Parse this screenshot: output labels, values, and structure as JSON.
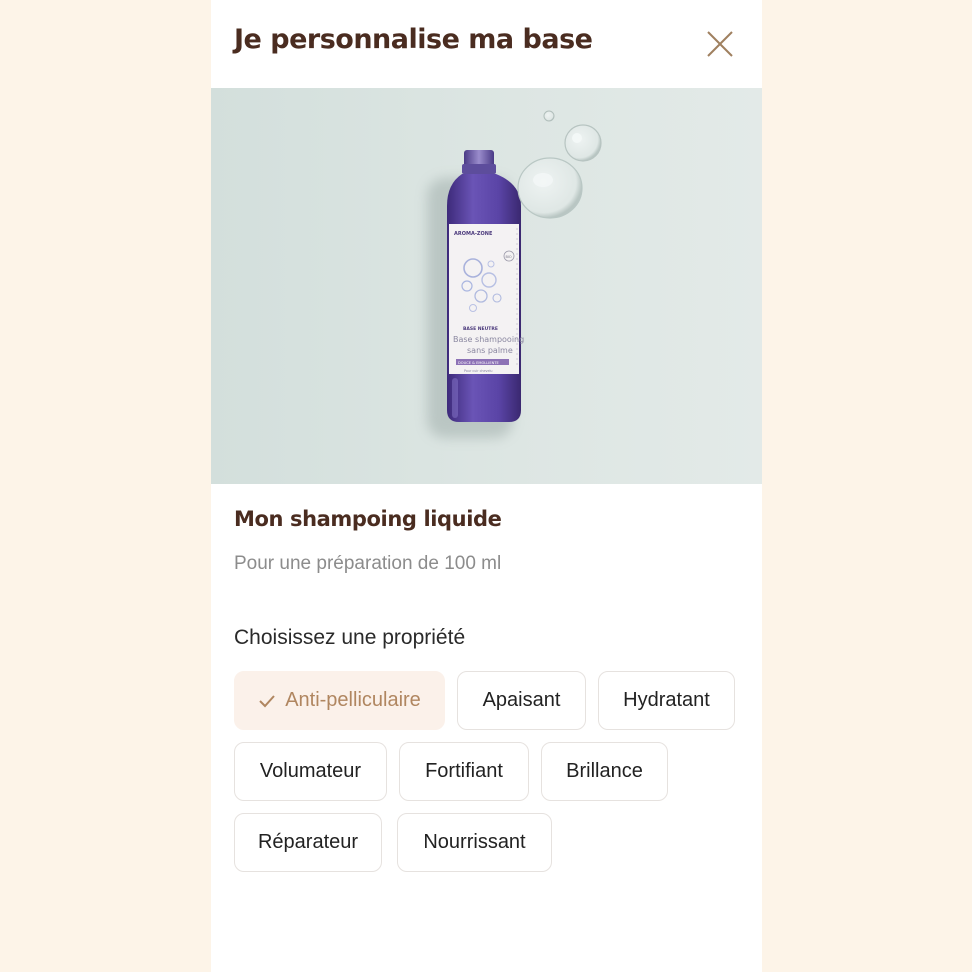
{
  "modal": {
    "title": "Je personnalise ma base",
    "close_icon": "close-icon"
  },
  "hero": {
    "image_desc_icon": "product-bottle-image",
    "label": {
      "brand": "AROMA-ZONE",
      "line1": "BASE NEUTRE",
      "line2": "Base shampooing",
      "line3": "sans palme",
      "band": "DOUCE & EMOLLIENTE",
      "small": "Pour cuir chevelu",
      "badge": "BIO"
    }
  },
  "product": {
    "title": "Mon shampoing liquide",
    "subtitle": "Pour une préparation de 100 ml"
  },
  "properties": {
    "heading": "Choisissez une propriété",
    "options": [
      {
        "label": "Anti-pelliculaire",
        "selected": true
      },
      {
        "label": "Apaisant",
        "selected": false
      },
      {
        "label": "Hydratant",
        "selected": false
      },
      {
        "label": "Volumateur",
        "selected": false
      },
      {
        "label": "Fortifiant",
        "selected": false
      },
      {
        "label": "Brillance",
        "selected": false
      },
      {
        "label": "Réparateur",
        "selected": false
      },
      {
        "label": "Nourrissant",
        "selected": false
      }
    ]
  },
  "colors": {
    "page_bg": "#fdf4e8",
    "title_brown": "#4a2c20",
    "accent_gold": "#b08660",
    "selected_bg": "#fbf1ea",
    "chip_border": "#e6e2df"
  }
}
